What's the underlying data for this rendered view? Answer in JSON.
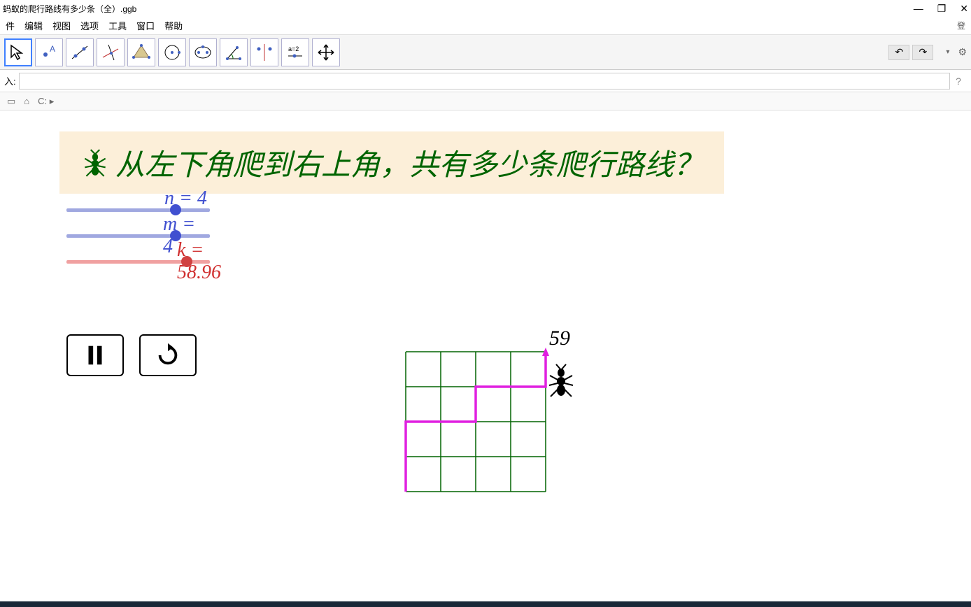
{
  "window": {
    "title": "蚂蚁的爬行路线有多少条（全）.ggb",
    "login": "登"
  },
  "menu": {
    "file": "件",
    "edit": "编辑",
    "view": "视图",
    "options": "选项",
    "tools": "工具",
    "window": "窗口",
    "help": "帮助"
  },
  "toolbar": {
    "undo": "↶",
    "redo": "↷",
    "dropdown": "▾",
    "gear": "⚙"
  },
  "input": {
    "label": "入:",
    "value": "",
    "help": "?"
  },
  "breadcrumb": {
    "home": "⌂",
    "c": "C:",
    "arrow": "▸"
  },
  "banner": {
    "text": "从左下角爬到右上角，共有多少条爬行路线？"
  },
  "sliders": {
    "n": {
      "label": "n = 4",
      "value": 4,
      "pos": 150
    },
    "m": {
      "label": "m = 4",
      "value": 4,
      "pos": 150
    },
    "k": {
      "label": "k = 58.96",
      "value": 58.96,
      "pos": 170
    }
  },
  "grid": {
    "count": "59",
    "rows": 4,
    "cols": 4,
    "cell": 50
  },
  "chart_data": {
    "type": "diagram",
    "description": "4x4 grid lattice paths",
    "n": 4,
    "m": 4,
    "path_count": 59,
    "highlighted_path": [
      [
        0,
        4
      ],
      [
        0,
        2
      ],
      [
        2,
        2
      ],
      [
        2,
        1
      ],
      [
        4,
        1
      ],
      [
        4,
        0
      ]
    ],
    "note": "coords in (col,row) from top-left; path shown in magenta from bottom-left to top-right"
  }
}
